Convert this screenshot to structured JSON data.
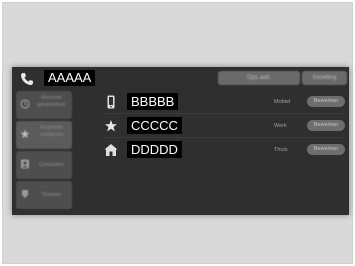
{
  "header": {
    "contact_name": "AAAAA",
    "open_button_label": "Ops.aall.",
    "settings_button_label": "Instelling"
  },
  "sidebar": {
    "items": [
      {
        "label": "Recente gesprekken",
        "icon": "history-icon",
        "active": false
      },
      {
        "label": "Favoriete contacten",
        "icon": "star-icon",
        "active": true
      },
      {
        "label": "Contacten",
        "icon": "contacts-icon",
        "active": false
      },
      {
        "label": "Toetsen",
        "icon": "keypad-icon",
        "active": false
      }
    ]
  },
  "numbers": [
    {
      "name": "BBBBB",
      "type": "Mobiel",
      "edit_label": "Bewerken",
      "icon": "mobile-phone-icon"
    },
    {
      "name": "CCCCC",
      "type": "Werk",
      "edit_label": "Bewerken",
      "icon": "star-icon"
    },
    {
      "name": "DDDDD",
      "type": "Thuis",
      "edit_label": "Bewerken",
      "icon": "home-icon"
    }
  ],
  "colors": {
    "screen_bg": "#2f2f2f",
    "button_bg": "#6a6a6a",
    "name_highlight_bg": "#000000",
    "text": "#ffffff"
  }
}
